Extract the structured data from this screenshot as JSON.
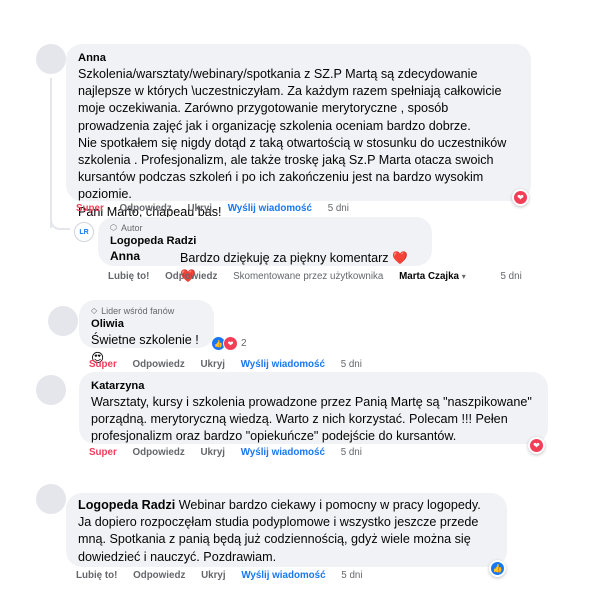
{
  "comments": [
    {
      "author": "Anna",
      "text": "Szkolenia/warsztaty/webinary/spotkania z SZ.P Martą są zdecydowanie najlepsze w których \\uczestniczyłam. Za każdym razem spełniają całkowicie moje oczekiwania. Zarówno przygotowanie merytoryczne , sposób prowadzenia zajęć jak i organizację szkolenia oceniam bardzo dobrze.\nNie spotkałem się nigdy dotąd z taką otwartością w stosunku do uczestników szkolenia . Profesjonalizm, ale także troskę jaką Sz.P Marta otacza swoich kursantów podczas szkoleń i po ich zakończeniu jest na bardzo wysokim poziomie.\nPani Marto, chapeau bas!",
      "actions": [
        "Super",
        "Odpowiedz",
        "Ukryj",
        "Wyślij wiadomość"
      ],
      "time": "5 dni"
    },
    {
      "badge": "Autor",
      "author": "Logopeda Radzi",
      "mention": "Anna",
      "text": "Bardzo dziękuję za piękny komentarz",
      "emoji": "❤️❤️",
      "actions": [
        "Lubię to!",
        "Odpowiedz"
      ],
      "meta_prefix": "Skomentowane przez użytkownika",
      "meta_name": "Marta Czajka",
      "time": "5 dni"
    },
    {
      "badge": "Lider wśród fanów",
      "author": "Oliwia",
      "text": "Świetne szkolenie !",
      "reaction_count": "2",
      "actions": [
        "Super",
        "Odpowiedz",
        "Ukryj",
        "Wyślij wiadomość"
      ],
      "time": "5 dni"
    },
    {
      "author": "Katarzyna",
      "text": "Warsztaty, kursy i szkolenia prowadzone przez Panią Martę są \"naszpikowane\" porządną. merytoryczną wiedzą. Warto z nich korzystać. Polecam !!! Pełen profesjonalizm oraz bardzo \"opiekuńcze\" podejście do kursantów.",
      "actions": [
        "Super",
        "Odpowiedz",
        "Ukryj",
        "Wyślij wiadomość"
      ],
      "time": "5 dni"
    },
    {
      "author": "Logopeda Radzi",
      "text": "Webinar bardzo ciekawy i pomocny w pracy logopedy. Ja dopiero rozpoczęłam studia podyplomowe i wszystko jeszcze przede mną. Spotkania z panią będą już codziennością, gdyż wiele można się dowiedzieć i nauczyć. Pozdrawiam.",
      "actions": [
        "Lubię to!",
        "Odpowiedz",
        "Ukryj",
        "Wyślij wiadomość"
      ],
      "time": "5 dni"
    }
  ],
  "colors": {
    "super": "#f33e58",
    "send": "#1877f2",
    "bubble": "#f0f2f5",
    "meta": "#65676b"
  }
}
